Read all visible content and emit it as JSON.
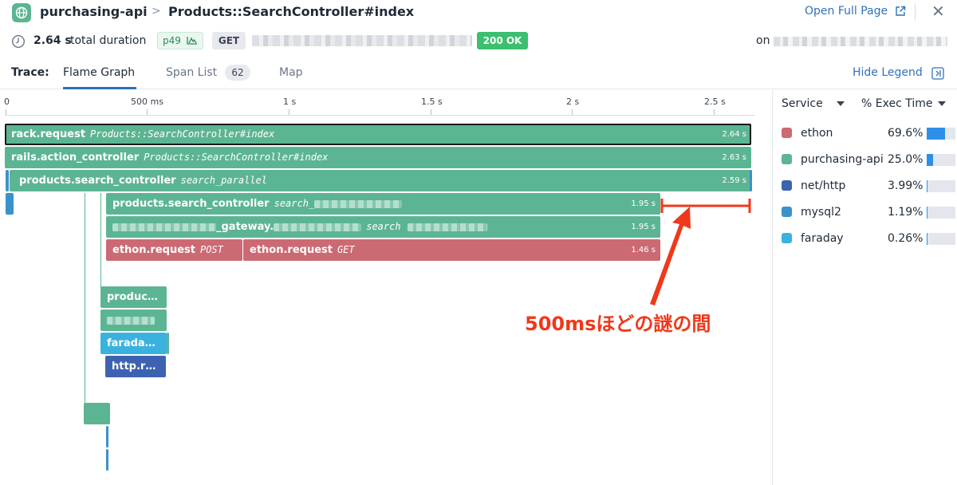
{
  "header": {
    "service": "purchasing-api",
    "separator": ">",
    "resource": "Products::SearchController#index",
    "open_full_page": "Open Full Page",
    "close": "✕"
  },
  "meta": {
    "duration": "2.64 s",
    "duration_label": "total duration",
    "percentile": "p49",
    "method": "GET",
    "status": "200 OK",
    "on_label": "on"
  },
  "tabs": {
    "label": "Trace:",
    "items": [
      "Flame Graph",
      "Span List",
      "Map"
    ],
    "active": "Flame Graph",
    "span_count": "62",
    "hide_legend": "Hide Legend"
  },
  "axis": {
    "ticks": [
      "0",
      "500 ms",
      "1 s",
      "1.5 s",
      "2 s",
      "2.5 s"
    ]
  },
  "spans": {
    "s1": {
      "name": "rack.request",
      "resource": "Products::SearchController#index",
      "duration": "2.64 s"
    },
    "s2": {
      "name": "rails.action_controller",
      "resource": "Products::SearchController#index",
      "duration": "2.63 s"
    },
    "s3": {
      "name": "products.search_controller",
      "resource": "search_parallel",
      "duration": "2.59 s"
    },
    "s4": {
      "name": "products.search_controller",
      "resource": "search_",
      "duration": "1.95 s"
    },
    "s5": {
      "name": "_gateway.",
      "resource": "search",
      "duration": "1.95 s"
    },
    "s6": {
      "name": "ethon.request",
      "resource": "POST"
    },
    "s7": {
      "name": "ethon.request",
      "resource": "GET",
      "duration": "1.46 s"
    },
    "s8": {
      "name": "produc…"
    },
    "s9": {
      "name": "farada…"
    },
    "s10": {
      "name": "http.r…"
    }
  },
  "annotation": "500msほどの謎の間",
  "legend": {
    "col_service": "Service",
    "col_exec": "% Exec Time",
    "rows": [
      {
        "service": "ethon",
        "pct": "69.6%",
        "value": 0.696,
        "color": "#cc6a73"
      },
      {
        "service": "purchasing-api",
        "pct": "25.0%",
        "value": 0.25,
        "color": "#5cb592"
      },
      {
        "service": "net/http",
        "pct": "3.99%",
        "value": 0.0399,
        "color": "#3d63b0"
      },
      {
        "service": "mysql2",
        "pct": "1.19%",
        "value": 0.0119,
        "color": "#3a92c9"
      },
      {
        "service": "faraday",
        "pct": "0.26%",
        "value": 0.0026,
        "color": "#3ab2e0"
      }
    ]
  }
}
